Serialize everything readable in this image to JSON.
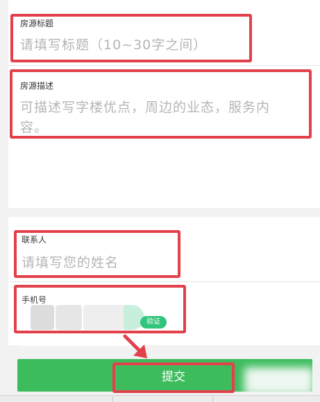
{
  "form": {
    "title_field": {
      "label": "房源标题",
      "placeholder": "请填写标题（10~30字之间）"
    },
    "description_field": {
      "label": "房源描述",
      "placeholder_line1": "可描述写字楼优点，周边的业态，服务内",
      "placeholder_line2": "容。"
    },
    "contact_field": {
      "label": "联系人",
      "placeholder": "请填写您的姓名"
    },
    "phone_field": {
      "label": "手机号",
      "verify_label": "验证"
    }
  },
  "submit_label": "提交",
  "colors": {
    "highlight_box": "#e2404b",
    "submit_green": "#3dbc5e",
    "placeholder_gray": "#b5b5b5"
  }
}
